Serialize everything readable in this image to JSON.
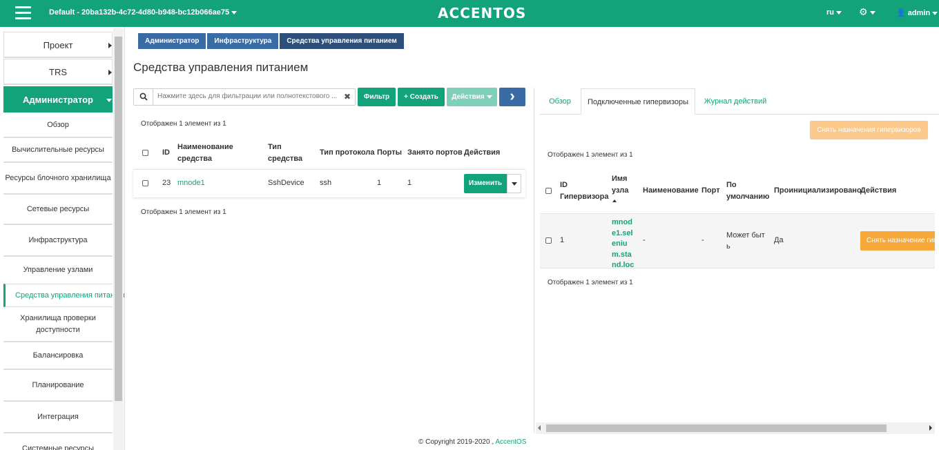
{
  "topbar": {
    "project": "Default - 20ba132b-4c72-4d80-b948-bc12b066ae75",
    "logo": "ACCENTOS",
    "lang": "ru",
    "user": "admin",
    "bg_color": "#12a37b"
  },
  "sidebar": {
    "top_items": [
      {
        "label": "Проект"
      },
      {
        "label": "TRS"
      },
      {
        "label": "Администратор"
      }
    ],
    "sub_items": [
      {
        "label": "Обзор"
      },
      {
        "label": "Вычислительные ресурсы"
      },
      {
        "label": "Ресурсы блочного хранилища"
      },
      {
        "label": "Сетевые ресурсы"
      },
      {
        "label": "Инфраструктура"
      },
      {
        "label": "Управление узлами"
      },
      {
        "label": "Средства управления питанием"
      },
      {
        "label": "Хранилища проверки доступности"
      },
      {
        "label": "Балансировка"
      },
      {
        "label": "Планирование"
      },
      {
        "label": "Интеграция"
      },
      {
        "label": "Системные ресурсы"
      }
    ]
  },
  "breadcrumb": [
    "Администратор",
    "Инфраструктура",
    "Средства управления питанием"
  ],
  "page_title": "Средства управления питанием",
  "toolbar": {
    "search_placeholder": "Нажмите здесь для фильтрации или полнотекстового ...",
    "clear_label": "✖",
    "filter_label": "Фильтр",
    "create_label": "+ Создать",
    "actions_label": "Действия",
    "go_label": "›"
  },
  "left_table": {
    "count_top": "Отображен 1 элемент из 1",
    "count_bottom": "Отображен 1 элемент из 1",
    "headers": {
      "id": "ID",
      "name": "Наименование средства",
      "type": "Тип средства",
      "protocol": "Тип протокола",
      "ports": "Порты",
      "busy": "Занято портов",
      "actions": "Действия"
    },
    "row": {
      "id": "23",
      "name": "mnode1",
      "type": "SshDevice",
      "protocol": "ssh",
      "ports": "1",
      "busy": "1",
      "edit_label": "Изменить"
    }
  },
  "right_panel": {
    "tabs": [
      "Обзор",
      "Подключенные гипервизоры",
      "Журнал действий"
    ],
    "unassign_all_label": "Снять назначения гипервизоров",
    "count_top": "Отображен 1 элемент из 1",
    "count_bottom": "Отображен 1 элемент из 1",
    "headers": {
      "hv_id": "ID Гипервизора",
      "node_name": "Имя узла",
      "name": "Наименование",
      "port": "Порт",
      "default": "По умолчанию",
      "initialized": "Проинициализировано",
      "actions": "Действия"
    },
    "row": {
      "hv_id": "1",
      "node_name": "mnode1.selenium.stand.loc",
      "name": "-",
      "port": "-",
      "default": "Может быть",
      "initialized": "Да",
      "action_label": "Снять назначение гипервизора"
    }
  },
  "footer": {
    "copyright": "© Copyright 2019-2020 ,",
    "link": "AccentOS"
  }
}
